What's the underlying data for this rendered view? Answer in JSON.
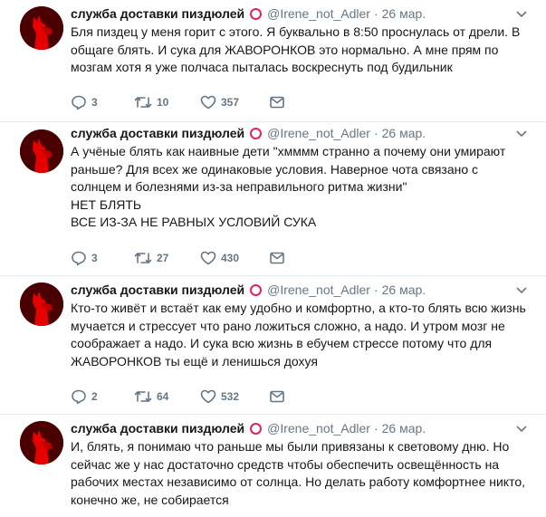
{
  "colors": {
    "badge": "#e0245e",
    "muted": "#657786",
    "text": "#14171a",
    "avatar_bg": "#5a0000",
    "avatar_figure": "#e60000"
  },
  "icons": {
    "avatar": "red-llama-avatar",
    "badge": "red-ring-icon",
    "reply": "reply-icon",
    "retweet": "retweet-icon",
    "like": "heart-icon",
    "dm": "envelope-icon",
    "menu": "chevron-down-icon"
  },
  "tweets": [
    {
      "author": "служба доставки пиздюлей",
      "handle": "@Irene_not_Adler",
      "separator": "·",
      "date": "26 мар.",
      "text": "Бля пиздец у меня горит с этого. Я буквально в 8:50 проснулась от дрели. В общаге блять. И сука для ЖАВОРОНКОВ это нормально. А мне прям по мозгам хотя я уже полчаса пыталась воскреснуть под будильник",
      "replies": "3",
      "retweets": "10",
      "likes": "357"
    },
    {
      "author": "служба доставки пиздюлей",
      "handle": "@Irene_not_Adler",
      "separator": "·",
      "date": "26 мар.",
      "text": "А учёные блять как наивные дети \"хмммм странно а почему они умирают раньше? Для всех же одинаковые условия. Наверное чота связано с солнцем и болезнями из-за неправильного ритма жизни\"\nНЕТ БЛЯТЬ\nВСЕ ИЗ-ЗА НЕ РАВНЫХ УСЛОВИЙ СУКА",
      "replies": "3",
      "retweets": "27",
      "likes": "430"
    },
    {
      "author": "служба доставки пиздюлей",
      "handle": "@Irene_not_Adler",
      "separator": "·",
      "date": "26 мар.",
      "text": "Кто-то живёт и встаёт как ему удобно и комфортно, а кто-то блять всю жизнь мучается и стрессует что рано ложиться сложно, а надо. И утром мозг не соображает а надо. И сука всю жизнь в ебучем стрессе потому что для ЖАВОРОНКОВ ты ещё и ленишься дохуя",
      "replies": "2",
      "retweets": "64",
      "likes": "532"
    },
    {
      "author": "служба доставки пиздюлей",
      "handle": "@Irene_not_Adler",
      "separator": "·",
      "date": "26 мар.",
      "text": "И, блять, я понимаю что раньше мы были привязаны к световому дню. Но сейчас же у нас достаточно средств чтобы обеспечить освещённость на рабочих местах независимо от солнца. Но делать работу комфортнее никто, конечно же, не собирается"
    }
  ]
}
